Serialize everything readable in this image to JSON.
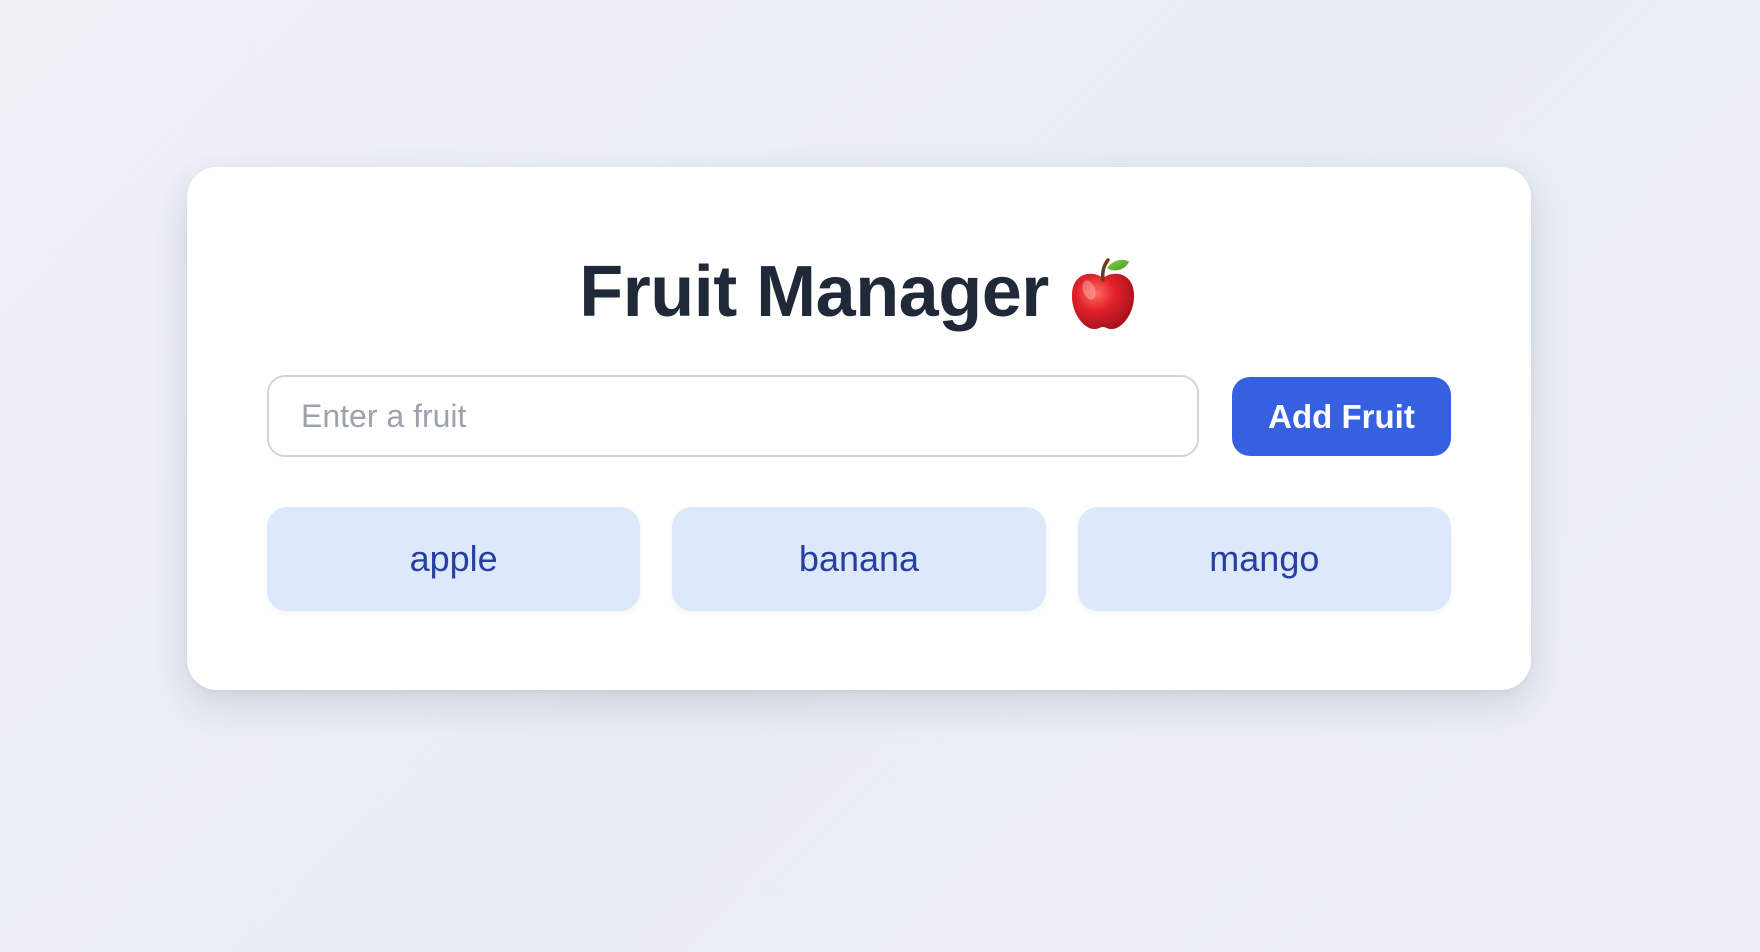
{
  "app": {
    "title": "Fruit Manager",
    "title_icon": "apple-icon"
  },
  "form": {
    "input_value": "",
    "input_placeholder": "Enter a fruit",
    "add_button_label": "Add Fruit"
  },
  "fruits": [
    {
      "label": "apple"
    },
    {
      "label": "banana"
    },
    {
      "label": "mango"
    }
  ],
  "colors": {
    "background": "#eef1f6",
    "card": "#ffffff",
    "title": "#1f2937",
    "accent": "#3560e0",
    "chip_background": "#dde8fa",
    "chip_text": "#2740a0",
    "placeholder": "#9ca3af"
  }
}
